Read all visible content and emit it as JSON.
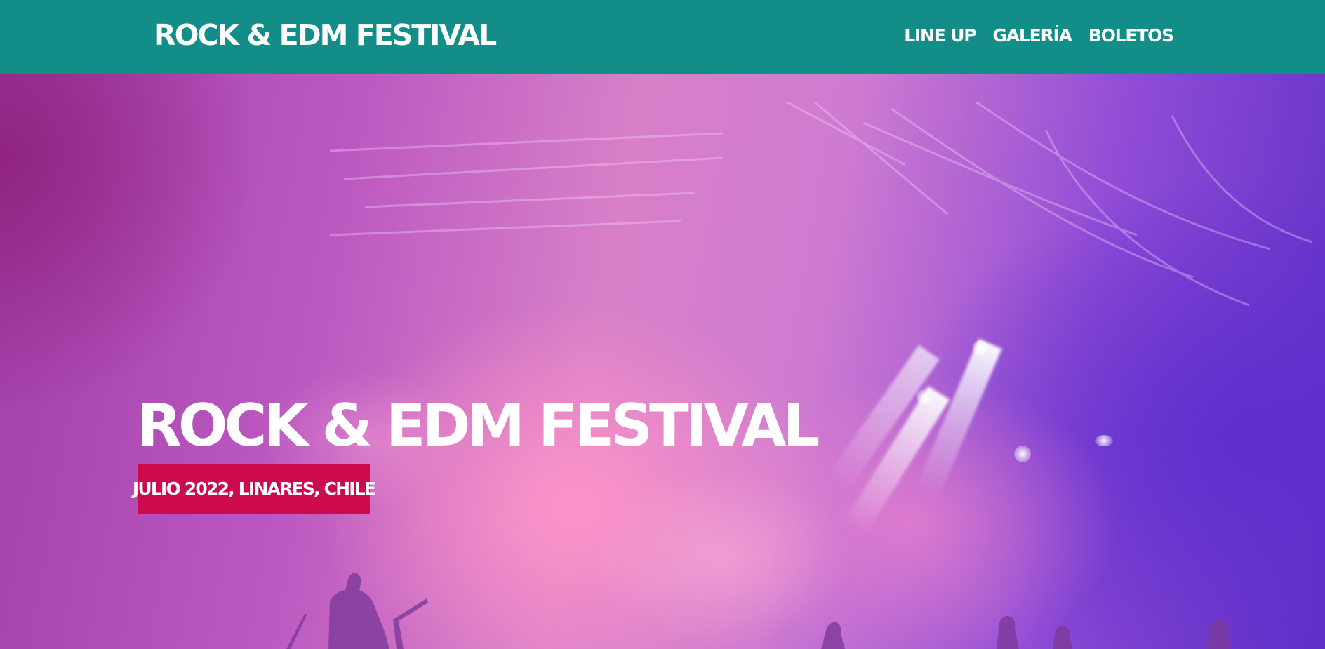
{
  "header": {
    "logo": "ROCK & EDM FESTIVAL",
    "nav": [
      {
        "label": "LINE UP"
      },
      {
        "label": "GALERÍA"
      },
      {
        "label": "BOLETOS"
      }
    ]
  },
  "hero": {
    "title": "ROCK & EDM FESTIVAL",
    "badge": "JULIO 2022, LINARES, CHILE"
  },
  "colors": {
    "header_bg": "#128d88",
    "badge_bg": "#cd0a4e",
    "text": "#ffffff",
    "hero_pink": "#f29ac8",
    "hero_purple": "#5d2fc6"
  }
}
